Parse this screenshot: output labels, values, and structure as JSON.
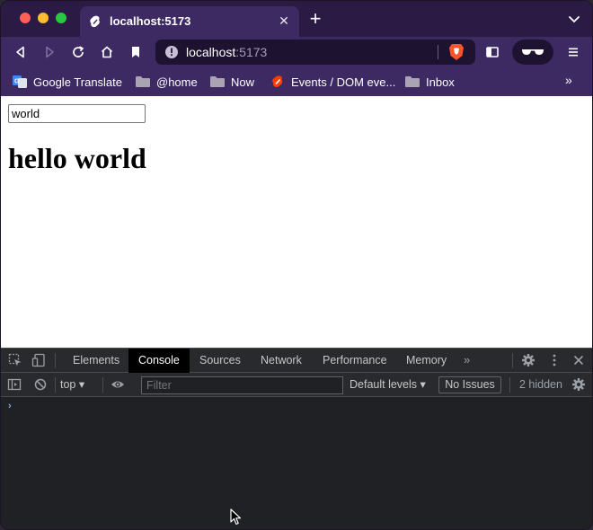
{
  "browser": {
    "tab": {
      "title": "localhost:5173",
      "close_label": "✕"
    },
    "new_tab_label": "+",
    "address": {
      "host": "localhost",
      "port": ":5173"
    },
    "bookmarks": [
      {
        "label": "Google Translate",
        "icon": "google-translate-icon"
      },
      {
        "label": "@home",
        "icon": "folder-icon"
      },
      {
        "label": "Now",
        "icon": "folder-icon"
      },
      {
        "label": "Events / DOM eve...",
        "icon": "svelte-icon"
      },
      {
        "label": "Inbox",
        "icon": "folder-icon"
      }
    ],
    "bookmarks_more": "»"
  },
  "page": {
    "input_value": "world",
    "heading": "hello world"
  },
  "devtools": {
    "tabs": [
      "Elements",
      "Console",
      "Sources",
      "Network",
      "Performance",
      "Memory"
    ],
    "active_tab": "Console",
    "more_tabs": "»",
    "context": "top",
    "filter_placeholder": "Filter",
    "levels": "Default levels",
    "issues": "No Issues",
    "hidden": "2 hidden",
    "prompt": "›"
  },
  "colors": {
    "chrome_purple": "#3d2a63",
    "devtools_bg": "#202124",
    "accent_blue": "#7cacf8"
  }
}
